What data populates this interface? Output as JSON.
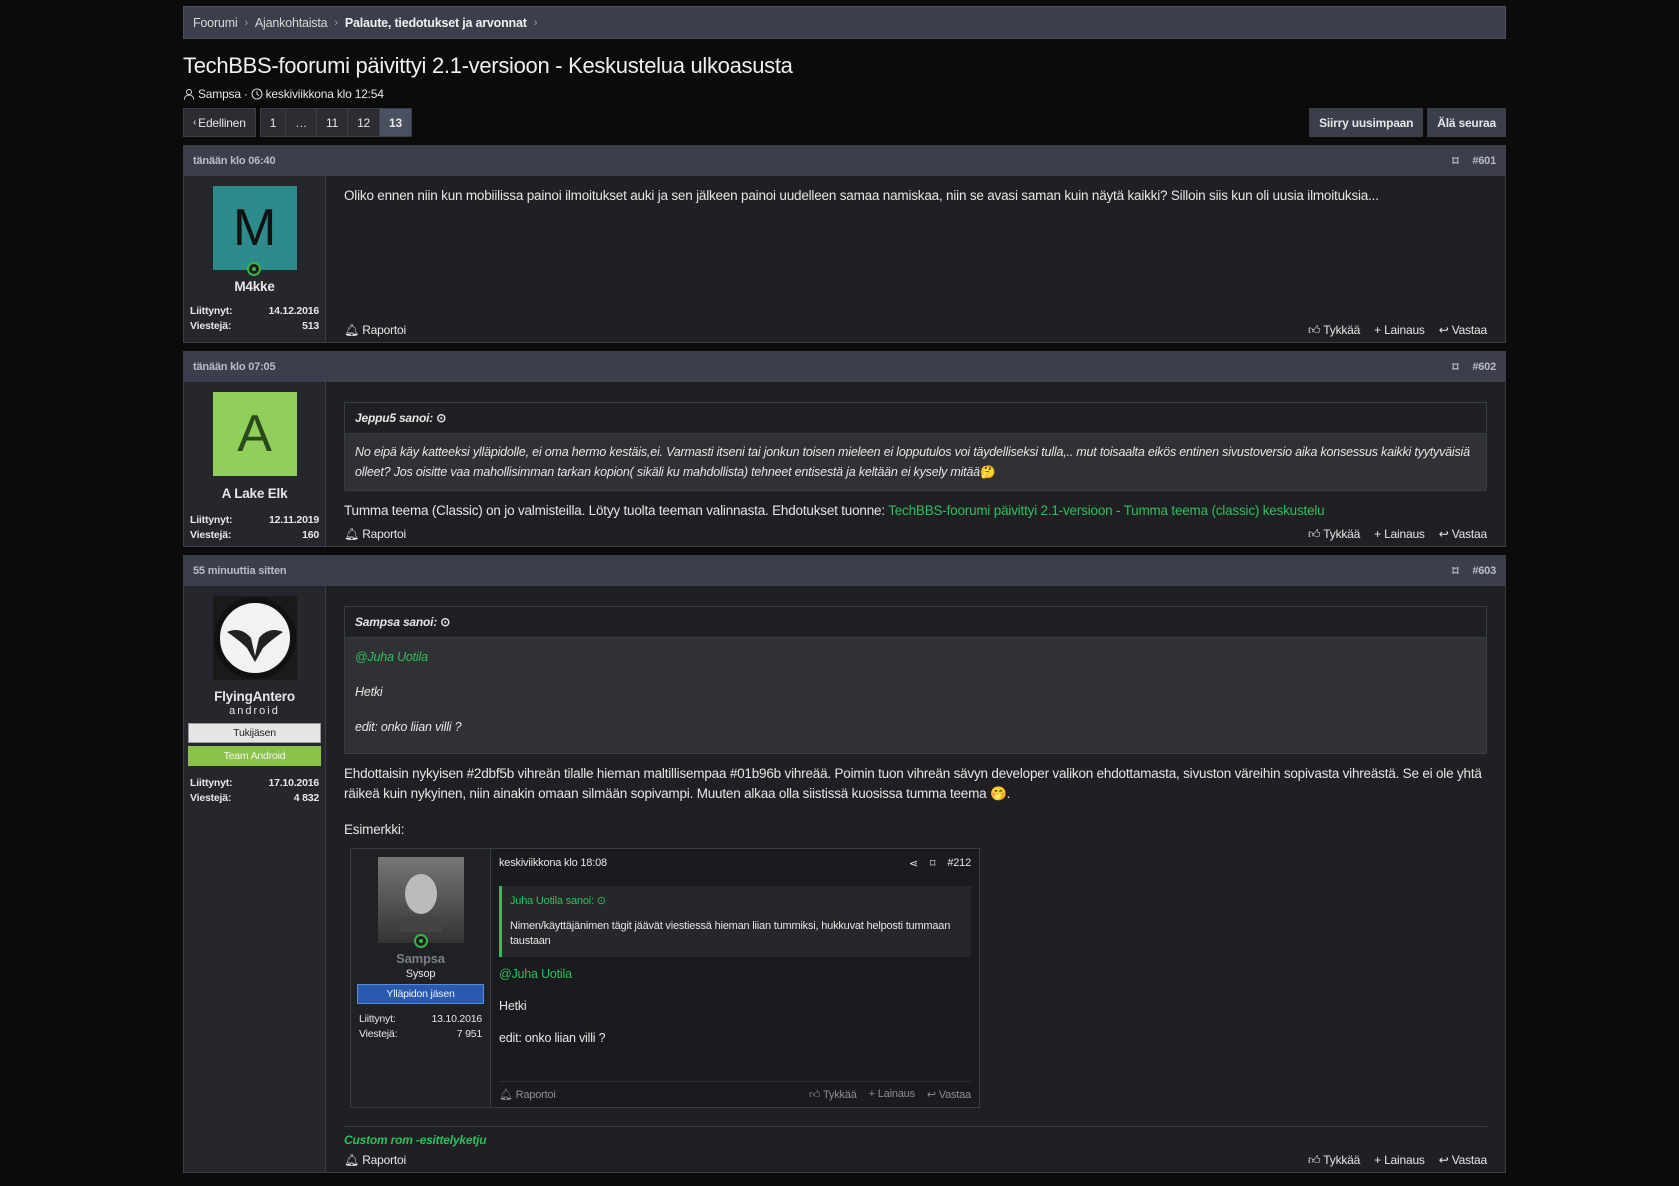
{
  "breadcrumb": [
    "Foorumi",
    "Ajankohtaista",
    "Palaute, tiedotukset ja arvonnat"
  ],
  "thread": {
    "title": "TechBBS-foorumi päivittyi 2.1-versioon - Keskustelua ulkoasusta",
    "author": "Sampsa",
    "date": "keskiviikkona klo 12:54"
  },
  "pager": {
    "prev": "Edellinen",
    "pages": [
      "1",
      "…",
      "11",
      "12",
      "13"
    ],
    "current": "13"
  },
  "actions": {
    "latest": "Siirry uusimpaan",
    "unwatch": "Älä seuraa"
  },
  "labels": {
    "joined": "Liittynyt:",
    "posts": "Viestejä:",
    "report": "Raportoi",
    "like": "Tykkää",
    "quote": "Lainaus",
    "reply": "Vastaa",
    "example": "Esimerkki:"
  },
  "posts": [
    {
      "time": "tänään klo 06:40",
      "num": "#601",
      "user": "M4kke",
      "avatar_letter": "M",
      "avatar_bg": "#2e8b8b",
      "avatar_fg": "#1a1a1a",
      "joined": "14.12.2016",
      "count": "513",
      "text": "Oliko ennen niin kun mobiilissa painoi ilmoitukset auki ja sen jälkeen painoi uudelleen samaa namiskaa, niin se avasi saman kuin näytä kaikki? Silloin siis kun oli uusia ilmoituksia..."
    },
    {
      "time": "tänään klo 07:05",
      "num": "#602",
      "user": "A Lake Elk",
      "avatar_letter": "A",
      "avatar_bg": "#8fcf5a",
      "avatar_fg": "#2a4a1a",
      "joined": "12.11.2019",
      "count": "160",
      "quote_author": "Jeppu5 sanoi:",
      "quote_text": "No eipä käy katteeksi ylläpidolle, ei oma hermo kestäis,ei. Varmasti itseni tai jonkun toisen mieleen ei lopputulos voi täydelliseksi tulla,.. mut toisaalta eikös entinen sivustoversio aika konsessus kaikki tyytyväisiä olleet? Jos oisitte vaa mahollisimman tarkan kopion( sikäli ku mahdollista) tehneet entisestä ja keltään ei kysely mitää",
      "text": "Tumma teema (Classic) on jo valmisteilla. Lötyy tuolta teeman valinnasta. Ehdotukset tuonne: ",
      "link": "TechBBS-foorumi päivittyi 2.1-versioon - Tumma teema (classic) keskustelu"
    },
    {
      "time": "55 minuuttia sitten",
      "num": "#603",
      "user": "FlyingAntero",
      "user_title": "android",
      "banner1": "Tukijäsen",
      "banner2": "Team Android",
      "joined": "17.10.2016",
      "count": "4 832",
      "quote_author": "Sampsa sanoi:",
      "quote_mention": "@Juha Uotila",
      "quote_l2": "Hetki",
      "quote_l3": "edit: onko liian villi ?",
      "text": "Ehdottaisin nykyisen #2dbf5b vihreän tilalle hieman maltillisempaa #01b96b vihreää. Poimin tuon vihreän sävyn developer valikon ehdottamasta, sivuston väreihin sopivasta vihreästä. Se ei ole yhtä räikeä kuin nykyinen, niin ainakin omaan silmään sopivampi. Muuten alkaa olla siistissä kuosissa tumma teema",
      "sig": "Custom rom -esittelyketju"
    }
  ],
  "sample": {
    "time": "keskiviikkona klo 18:08",
    "num": "#212",
    "user": "Sampsa",
    "user_title": "Sysop",
    "banner": "Ylläpidon jäsen",
    "joined": "13.10.2016",
    "count": "7 951",
    "quote_author": "Juha Uotila sanoi:",
    "quote_text": "Nimen/käyttäjänimen tägit jäävät viestiessä hieman liian tummiksi, hukkuvat helposti tummaan taustaan",
    "mention": "@Juha Uotila",
    "l2": "Hetki",
    "l3": "edit: onko liian villi ?"
  },
  "colors": {
    "accent": "#2dbf5b",
    "accent_alt": "#01b96b"
  }
}
